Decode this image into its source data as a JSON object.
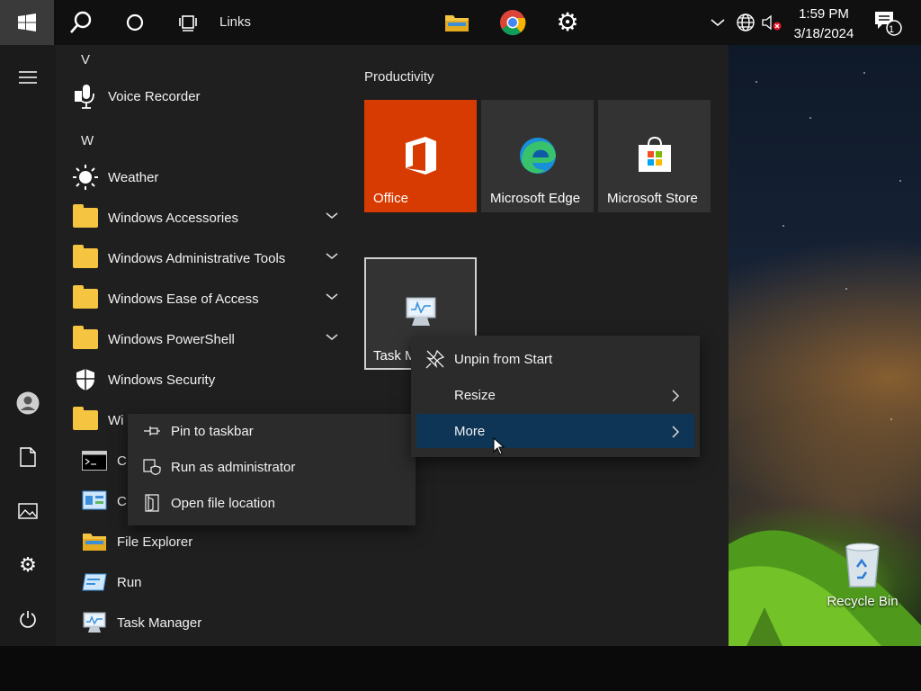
{
  "taskbar": {
    "links_label": "Links",
    "clock": {
      "time": "1:59 PM",
      "date": "3/18/2024"
    },
    "notification_count": "1"
  },
  "start_menu": {
    "app_list": {
      "groups": [
        {
          "letter": "V",
          "items": [
            {
              "label": "Voice Recorder",
              "icon": "microphone-icon",
              "expandable": false
            }
          ]
        },
        {
          "letter": "W",
          "items": [
            {
              "label": "Weather",
              "icon": "sun-icon",
              "expandable": false
            },
            {
              "label": "Windows Accessories",
              "icon": "folder-icon",
              "expandable": true
            },
            {
              "label": "Windows Administrative Tools",
              "icon": "folder-icon",
              "expandable": true
            },
            {
              "label": "Windows Ease of Access",
              "icon": "folder-icon",
              "expandable": true
            },
            {
              "label": "Windows PowerShell",
              "icon": "folder-icon",
              "expandable": true
            },
            {
              "label": "Windows Security",
              "icon": "shield-icon",
              "expandable": false
            },
            {
              "label": "Wi",
              "icon": "folder-icon",
              "expandable": false
            }
          ]
        }
      ],
      "sub_items": [
        {
          "label": "C",
          "icon": "command-prompt-icon"
        },
        {
          "label": "C",
          "icon": "control-panel-icon"
        },
        {
          "label": "File Explorer",
          "icon": "file-explorer-icon"
        },
        {
          "label": "Run",
          "icon": "run-icon"
        },
        {
          "label": "Task Manager",
          "icon": "task-manager-icon"
        }
      ]
    },
    "tiles": {
      "group_title": "Productivity",
      "items": [
        {
          "label": "Office",
          "color": "#d83b01"
        },
        {
          "label": "Microsoft Edge",
          "color": "#333333"
        },
        {
          "label": "Microsoft Store",
          "color": "#333333"
        },
        {
          "label": "Task M",
          "color": "#333333"
        }
      ]
    }
  },
  "tile_context_menu": {
    "items": [
      {
        "label": "Unpin from Start",
        "icon": "unpin-icon",
        "submenu": false
      },
      {
        "label": "Resize",
        "icon": "",
        "submenu": true
      },
      {
        "label": "More",
        "icon": "",
        "submenu": true,
        "highlighted": true
      }
    ]
  },
  "more_submenu": {
    "items": [
      {
        "label": "Pin to taskbar",
        "icon": "pin-taskbar-icon"
      },
      {
        "label": "Run as administrator",
        "icon": "admin-shield-icon"
      },
      {
        "label": "Open file location",
        "icon": "file-location-icon"
      }
    ]
  },
  "desktop": {
    "recycle_bin_label": "Recycle Bin"
  },
  "colors": {
    "accent_highlight": "#0e3556",
    "office_tile": "#d83b01",
    "start_button_bg": "#3a3a3a"
  }
}
